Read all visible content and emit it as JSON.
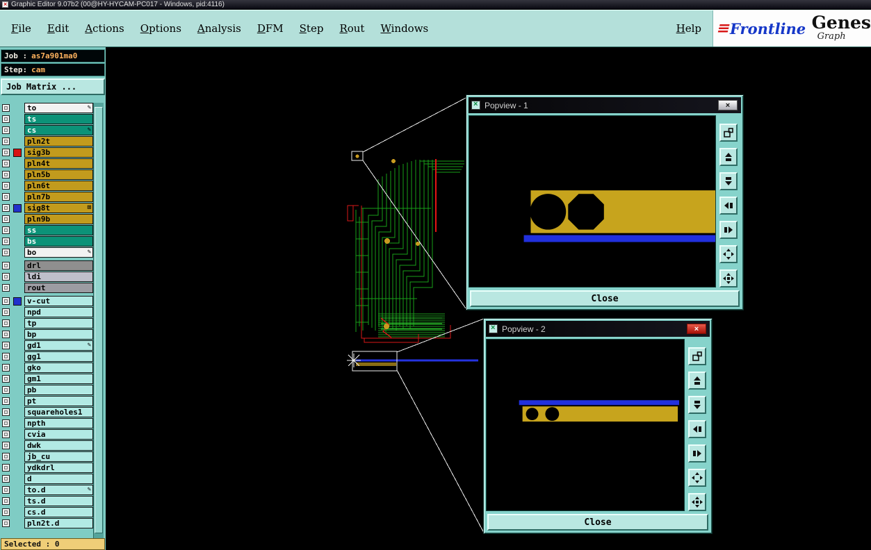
{
  "window": {
    "title": "Graphic Editor 9.07b2 (00@HY-HYCAM-PC017 - Windows, pid:4116)"
  },
  "menu_bar": {
    "items": [
      "File",
      "Edit",
      "Actions",
      "Options",
      "Analysis",
      "DFM",
      "Step",
      "Rout",
      "Windows"
    ],
    "help_label": "Help",
    "brand": {
      "frontline": "Frontline",
      "genesis_top": "Genes",
      "genesis_bottom": "Graph"
    }
  },
  "sidebar": {
    "job_prefix": "Job :",
    "job_value": "as7a901ma0",
    "step_prefix": "Step:",
    "step_value": "cam",
    "job_matrix_label": "Job Matrix ...",
    "selected_label": "Selected : 0",
    "layers": [
      {
        "name": "to",
        "bg": "#f2f2f2",
        "fg": "#000000",
        "badge": "pencil"
      },
      {
        "name": "ts",
        "bg": "#0c9278",
        "fg": "#ffffff"
      },
      {
        "name": "cs",
        "bg": "#0c9278",
        "fg": "#ffffff",
        "badge": "pencil"
      },
      {
        "name": "pln2t",
        "bg": "#c29b1d",
        "fg": "#000000"
      },
      {
        "name": "sig3b",
        "bg": "#c29b1d",
        "fg": "#000000",
        "marker": "#d81414"
      },
      {
        "name": "pln4t",
        "bg": "#c29b1d",
        "fg": "#000000"
      },
      {
        "name": "pln5b",
        "bg": "#c29b1d",
        "fg": "#000000"
      },
      {
        "name": "pln6t",
        "bg": "#c29b1d",
        "fg": "#000000"
      },
      {
        "name": "pln7b",
        "bg": "#c29b1d",
        "fg": "#000000"
      },
      {
        "name": "sig8t",
        "bg": "#c29b1d",
        "fg": "#000000",
        "marker": "#2231cc",
        "badge": "grid"
      },
      {
        "name": "pln9b",
        "bg": "#c29b1d",
        "fg": "#000000"
      },
      {
        "name": "ss",
        "bg": "#0c9278",
        "fg": "#ffffff"
      },
      {
        "name": "bs",
        "bg": "#0c9278",
        "fg": "#ffffff"
      },
      {
        "name": "bo",
        "bg": "#f2f2f2",
        "fg": "#000000",
        "badge": "pencil"
      },
      {
        "name": "drl",
        "bg": "#8f8f8f",
        "fg": "#000000",
        "gap": true
      },
      {
        "name": "ldi",
        "bg": "#bfbfca",
        "fg": "#000000"
      },
      {
        "name": "rout",
        "bg": "#9c9ca2",
        "fg": "#000000"
      },
      {
        "name": "v-cut",
        "bg": "#b2eae4",
        "fg": "#000000",
        "marker": "#2231cc",
        "gap": true
      },
      {
        "name": "npd",
        "bg": "#b2eae4",
        "fg": "#000000"
      },
      {
        "name": "tp",
        "bg": "#b2eae4",
        "fg": "#000000"
      },
      {
        "name": "bp",
        "bg": "#b2eae4",
        "fg": "#000000"
      },
      {
        "name": "gd1",
        "bg": "#b2eae4",
        "fg": "#000000",
        "badge": "pencil"
      },
      {
        "name": "gg1",
        "bg": "#b2eae4",
        "fg": "#000000"
      },
      {
        "name": "gko",
        "bg": "#b2eae4",
        "fg": "#000000"
      },
      {
        "name": "gm1",
        "bg": "#b2eae4",
        "fg": "#000000"
      },
      {
        "name": "pb",
        "bg": "#b2eae4",
        "fg": "#000000"
      },
      {
        "name": "pt",
        "bg": "#b2eae4",
        "fg": "#000000"
      },
      {
        "name": "squareholes1",
        "bg": "#b2eae4",
        "fg": "#000000"
      },
      {
        "name": "npth",
        "bg": "#b2eae4",
        "fg": "#000000"
      },
      {
        "name": "cvia",
        "bg": "#b2eae4",
        "fg": "#000000"
      },
      {
        "name": "dwk",
        "bg": "#b2eae4",
        "fg": "#000000"
      },
      {
        "name": "jb_cu",
        "bg": "#b2eae4",
        "fg": "#000000"
      },
      {
        "name": "ydkdrl",
        "bg": "#b2eae4",
        "fg": "#000000"
      },
      {
        "name": "d",
        "bg": "#b2eae4",
        "fg": "#000000"
      },
      {
        "name": "to.d",
        "bg": "#b2eae4",
        "fg": "#000000",
        "badge": "pencil"
      },
      {
        "name": "ts.d",
        "bg": "#b2eae4",
        "fg": "#000000"
      },
      {
        "name": "cs.d",
        "bg": "#b2eae4",
        "fg": "#000000"
      },
      {
        "name": "pln2t.d",
        "bg": "#b2eae4",
        "fg": "#000000"
      }
    ]
  },
  "popview1": {
    "title": "Popview - 1",
    "close_label": "Close"
  },
  "popview2": {
    "title": "Popview - 2",
    "close_label": "Close"
  },
  "popview_toolbar": [
    "zoom-window",
    "scroll-up",
    "scroll-down",
    "scroll-left",
    "scroll-right",
    "expand",
    "pan"
  ],
  "colors": {
    "ui_teal": "#7fccc4",
    "layer_gold": "#c29b1d",
    "trace_green": "#18a018",
    "board_red": "#d81818",
    "vcut_blue": "#2130dd",
    "pad_gold": "#c7a41d"
  }
}
